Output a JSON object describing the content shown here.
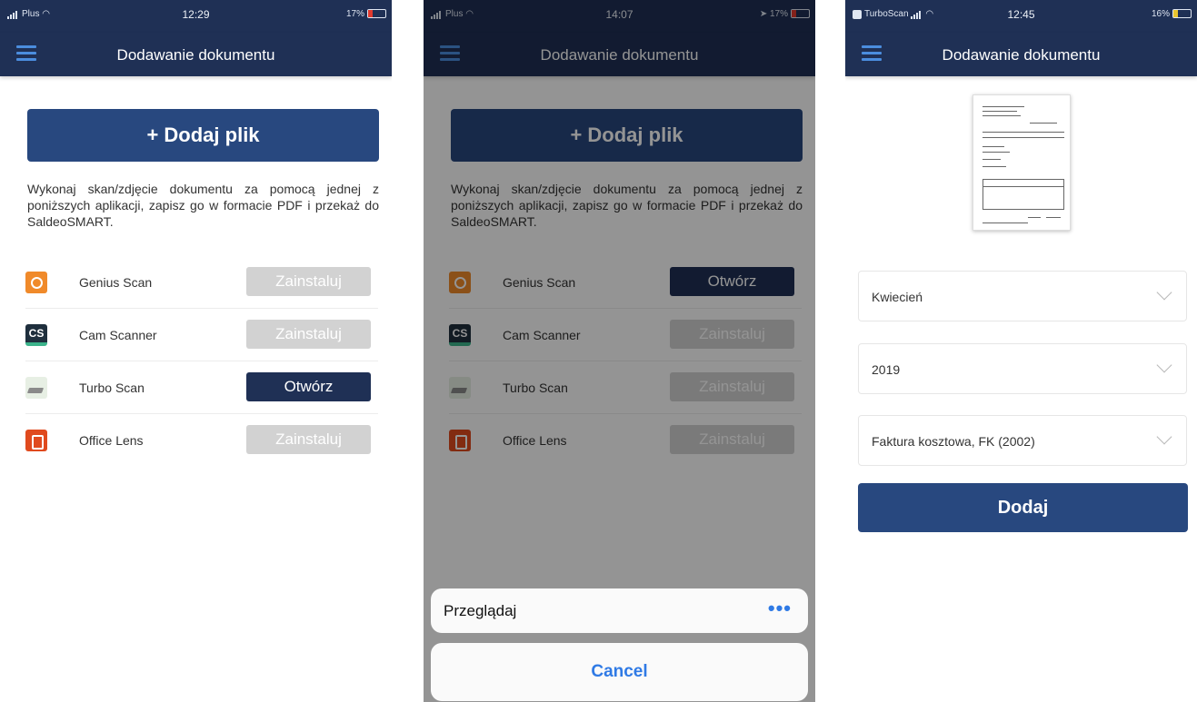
{
  "screens": [
    {
      "status": {
        "carrier": "Plus",
        "time": "12:29",
        "battery": "17%"
      },
      "title": "Dodawanie dokumentu",
      "add_file_label": "+ Dodaj plik",
      "instructions": "Wykonaj skan/zdjęcie dokumentu za pomocą jednej z poniższych aplikacji, zapisz go w formacie PDF i przekaż do SaldeoSMART.",
      "apps": [
        {
          "name": "Genius Scan",
          "action": "Zainstaluj",
          "icon": "genius-scan-icon"
        },
        {
          "name": "Cam Scanner",
          "action": "Zainstaluj",
          "icon": "cam-scanner-icon",
          "icon_text": "CS"
        },
        {
          "name": "Turbo Scan",
          "action": "Otwórz",
          "icon": "turbo-scan-icon"
        },
        {
          "name": "Office Lens",
          "action": "Zainstaluj",
          "icon": "office-lens-icon"
        }
      ]
    },
    {
      "status": {
        "carrier": "Plus",
        "time": "14:07",
        "battery": "17%"
      },
      "title": "Dodawanie dokumentu",
      "add_file_label": "+ Dodaj plik",
      "instructions": "Wykonaj skan/zdjęcie dokumentu za pomocą jednej z poniższych aplikacji, zapisz go w formacie PDF i przekaż do SaldeoSMART.",
      "apps": [
        {
          "name": "Genius Scan",
          "action": "Otwórz",
          "icon": "genius-scan-icon"
        },
        {
          "name": "Cam Scanner",
          "action": "Zainstaluj",
          "icon": "cam-scanner-icon",
          "icon_text": "CS"
        },
        {
          "name": "Turbo Scan",
          "action": "Zainstaluj",
          "icon": "turbo-scan-icon"
        },
        {
          "name": "Office Lens",
          "action": "Zainstaluj",
          "icon": "office-lens-icon"
        }
      ],
      "sheet": {
        "browse_label": "Przeglądaj",
        "more_label": "•••",
        "cancel_label": "Cancel"
      }
    },
    {
      "status": {
        "carrier": "TurboScan",
        "time": "12:45",
        "battery": "16%"
      },
      "title": "Dodawanie dokumentu",
      "selects": [
        {
          "value": "Kwiecień"
        },
        {
          "value": "2019"
        },
        {
          "value": "Faktura kosztowa, FK (2002)"
        }
      ],
      "add_label": "Dodaj"
    }
  ],
  "colors": {
    "nav": "#1f3055",
    "primary_button": "#28487f",
    "open_button": "#1f3055",
    "install_button": "#d2d2d2",
    "ios_blue": "#2f7ae5"
  }
}
